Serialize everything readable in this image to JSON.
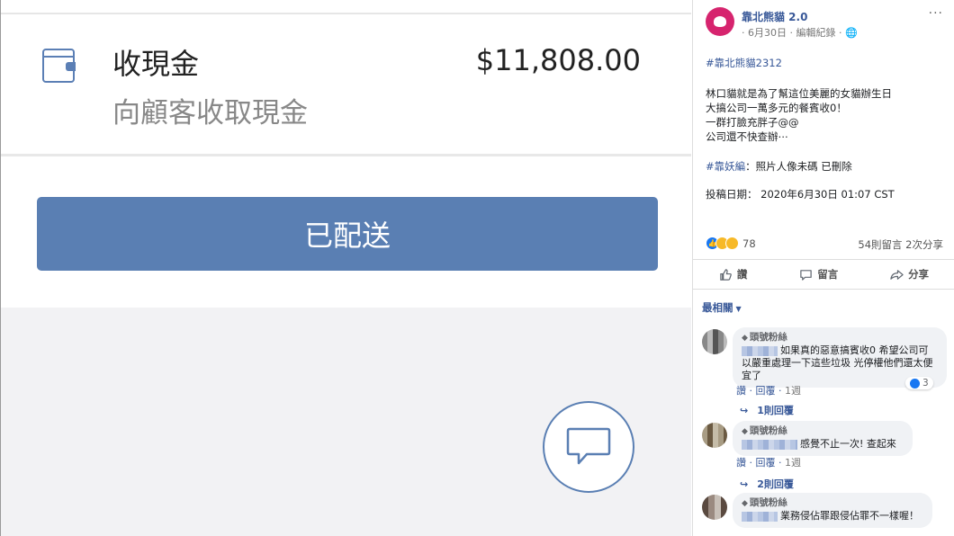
{
  "left": {
    "title": "收現金",
    "amount": "$11,808.00",
    "subtitle": "向顧客收取現金",
    "button_label": "已配送"
  },
  "post": {
    "page_name": "靠北熊貓 2.0",
    "meta": "· 6月30日 · 編輯紀錄 · 🌐",
    "more": "···",
    "hashtag": "#靠北熊貓2312",
    "body": [
      "林口貓就是為了幫這位美麗的女貓辦生日",
      "大搞公司一萬多元的餐賓收0！",
      "一群打臉充胖子@@",
      "公司還不快查辦⋯"
    ],
    "tag_label": "#靠妖編",
    "tag_text": "：照片人像未碼 已刪除",
    "date_line": "投稿日期： 2020年6月30日 01:07 CST",
    "reaction_count": "78",
    "comment_share": "54則留言 2次分享",
    "actions": {
      "like": "讚",
      "comment": "留言",
      "share": "分享"
    },
    "sort_label": "最相關"
  },
  "comments": [
    {
      "badge": "頭號粉絲",
      "text": "如果真的惡意搞賓收0 希望公司可以嚴重處理一下這些垃圾 光停權他們還太便宜了",
      "actions": "讚 · 回覆 · ",
      "time": "1週",
      "like_count": "3",
      "replies": "1則回覆"
    },
    {
      "badge": "頭號粉絲",
      "text": "感覺不止一次! 查起來",
      "actions": "讚 · 回覆 · ",
      "time": "1週",
      "replies": "2則回覆"
    },
    {
      "badge": "頭號粉絲",
      "text": "業務侵佔罪跟侵佔罪不一樣喔！"
    }
  ]
}
